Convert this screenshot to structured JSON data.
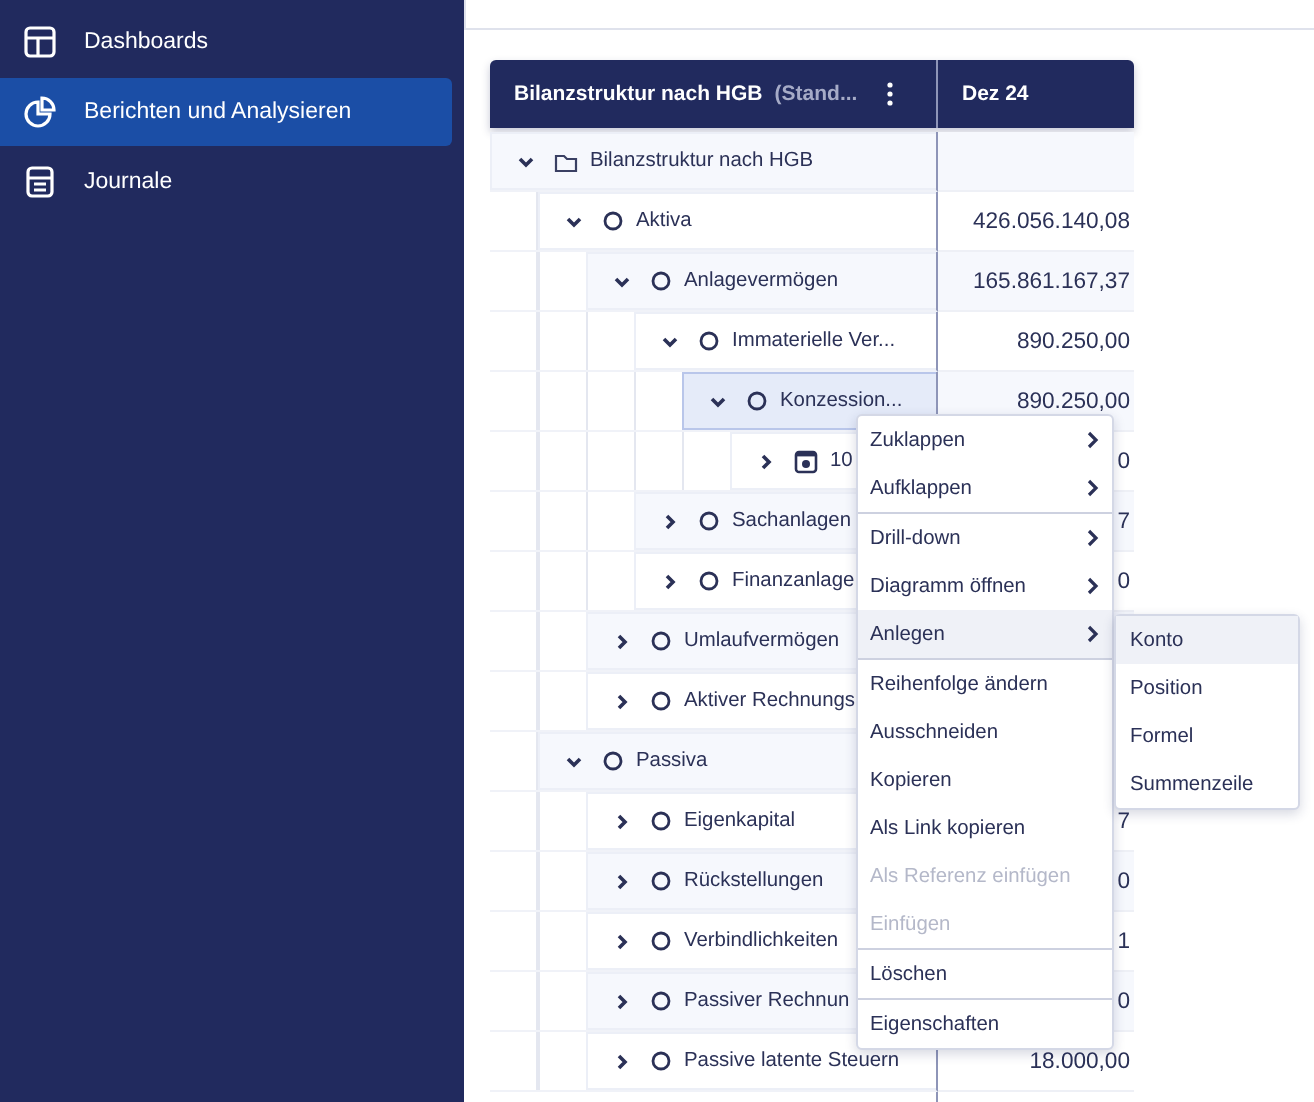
{
  "sidebar": {
    "items": [
      {
        "label": "Dashboards",
        "kind": "layout",
        "selected": false
      },
      {
        "label": "Berichten und Analysieren",
        "kind": "pie",
        "selected": true
      },
      {
        "label": "Journale",
        "kind": "journal",
        "selected": false
      }
    ]
  },
  "table": {
    "header": {
      "title": "Bilanzstruktur nach HGB",
      "subtitle": "(Stand...",
      "column": "Dez 24"
    },
    "rows": [
      {
        "label": "Bilanzstruktur nach HGB",
        "kind": "folder",
        "expanded": true,
        "selected": false,
        "children": [
          {
            "label": "Aktiva",
            "kind": "position",
            "expanded": true,
            "selected": false,
            "value": "426.056.140,08",
            "children": [
              {
                "label": "Anlagevermögen",
                "kind": "position",
                "expanded": true,
                "selected": false,
                "value": "165.861.167,37",
                "children": [
                  {
                    "label": "Immaterielle Ver...",
                    "kind": "position",
                    "expanded": true,
                    "selected": false,
                    "value": "890.250,00",
                    "children": [
                      {
                        "label": "Konzession...",
                        "kind": "position",
                        "expanded": true,
                        "selected": true,
                        "value": "890.250,00",
                        "children": [
                          {
                            "label": "10",
                            "kind": "account",
                            "expanded": false,
                            "selected": false,
                            "value": "0"
                          }
                        ]
                      }
                    ]
                  },
                  {
                    "label": "Sachanlagen",
                    "kind": "position",
                    "expanded": false,
                    "selected": false,
                    "value": "7"
                  },
                  {
                    "label": "Finanzanlage",
                    "kind": "position",
                    "expanded": false,
                    "selected": false,
                    "value": "0"
                  }
                ]
              },
              {
                "label": "Umlaufvermögen",
                "kind": "position",
                "expanded": false,
                "selected": false
              },
              {
                "label": "Aktiver Rechnungs",
                "kind": "position",
                "expanded": false,
                "selected": false
              }
            ]
          },
          {
            "label": "Passiva",
            "kind": "position",
            "expanded": true,
            "selected": false,
            "children": [
              {
                "label": "Eigenkapital",
                "kind": "position",
                "expanded": false,
                "selected": false,
                "value": "7"
              },
              {
                "label": "Rückstellungen",
                "kind": "position",
                "expanded": false,
                "selected": false,
                "value": "0"
              },
              {
                "label": "Verbindlichkeiten",
                "kind": "position",
                "expanded": false,
                "selected": false,
                "value": "1"
              },
              {
                "label": "Passiver Rechnun",
                "kind": "position",
                "expanded": false,
                "selected": false,
                "value": "0"
              },
              {
                "label": "Passive latente Steuern",
                "kind": "position",
                "expanded": false,
                "selected": false,
                "value": "18.000,00"
              }
            ]
          }
        ]
      }
    ]
  },
  "context_menu": {
    "groups": [
      [
        {
          "label": "Zuklappen",
          "submenu": true,
          "selected": false,
          "disabled": false
        },
        {
          "label": "Aufklappen",
          "submenu": true,
          "selected": false,
          "disabled": false
        }
      ],
      [
        {
          "label": "Drill-down",
          "submenu": true,
          "selected": false,
          "disabled": false
        },
        {
          "label": "Diagramm öffnen",
          "submenu": true,
          "selected": false,
          "disabled": false
        },
        {
          "label": "Anlegen",
          "submenu": true,
          "selected": true,
          "disabled": false
        }
      ],
      [
        {
          "label": "Reihenfolge ändern",
          "submenu": false,
          "selected": false,
          "disabled": false
        },
        {
          "label": "Ausschneiden",
          "submenu": false,
          "selected": false,
          "disabled": false
        },
        {
          "label": "Kopieren",
          "submenu": false,
          "selected": false,
          "disabled": false
        },
        {
          "label": "Als Link kopieren",
          "submenu": false,
          "selected": false,
          "disabled": false
        },
        {
          "label": "Als Referenz einfügen",
          "submenu": false,
          "selected": false,
          "disabled": true
        },
        {
          "label": "Einfügen",
          "submenu": false,
          "selected": false,
          "disabled": true
        }
      ],
      [
        {
          "label": "Löschen",
          "submenu": false,
          "selected": false,
          "disabled": false
        }
      ],
      [
        {
          "label": "Eigenschaften",
          "submenu": false,
          "selected": false,
          "disabled": false
        }
      ]
    ]
  },
  "submenu": {
    "items": [
      {
        "label": "Konto",
        "selected": true
      },
      {
        "label": "Position",
        "selected": false
      },
      {
        "label": "Formel",
        "selected": false
      },
      {
        "label": "Summenzeile",
        "selected": false
      }
    ]
  }
}
